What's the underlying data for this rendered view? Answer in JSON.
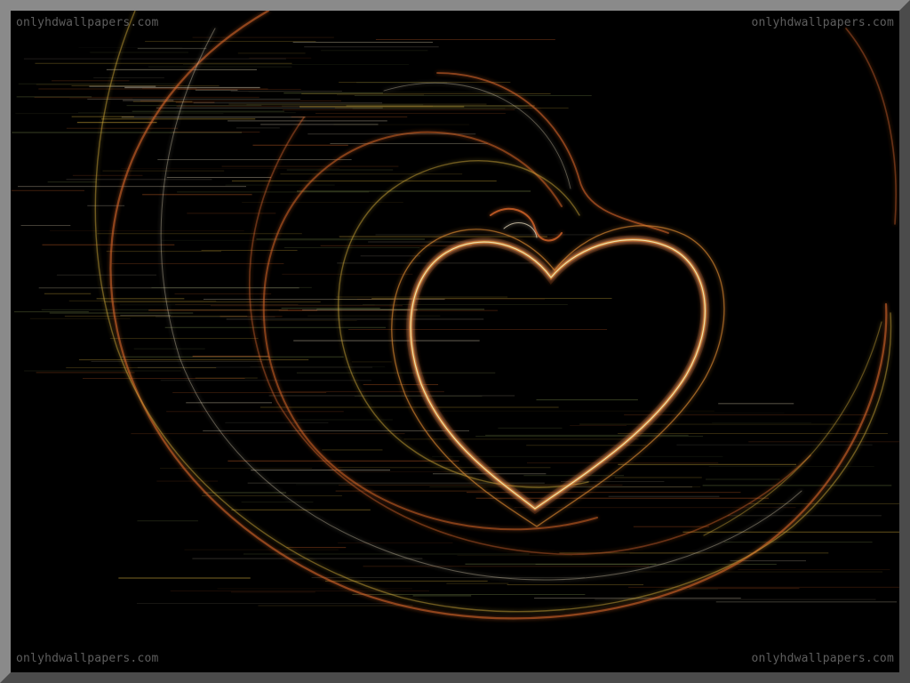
{
  "watermarks": {
    "top_left": "onlyhdwallpapers.com",
    "top_right": "onlyhdwallpapers.com",
    "bottom_left": "onlyhdwallpapers.com",
    "bottom_right": "onlyhdwallpapers.com"
  },
  "colors": {
    "background": "#000000",
    "watermark": "#5e5e5e",
    "streak_warm": "#e06a2a",
    "streak_gold": "#d9b23c",
    "streak_pale": "#f3e6c6",
    "streak_green": "#7a8a4a"
  },
  "artwork": {
    "subject": "heart-fractal-icon"
  }
}
